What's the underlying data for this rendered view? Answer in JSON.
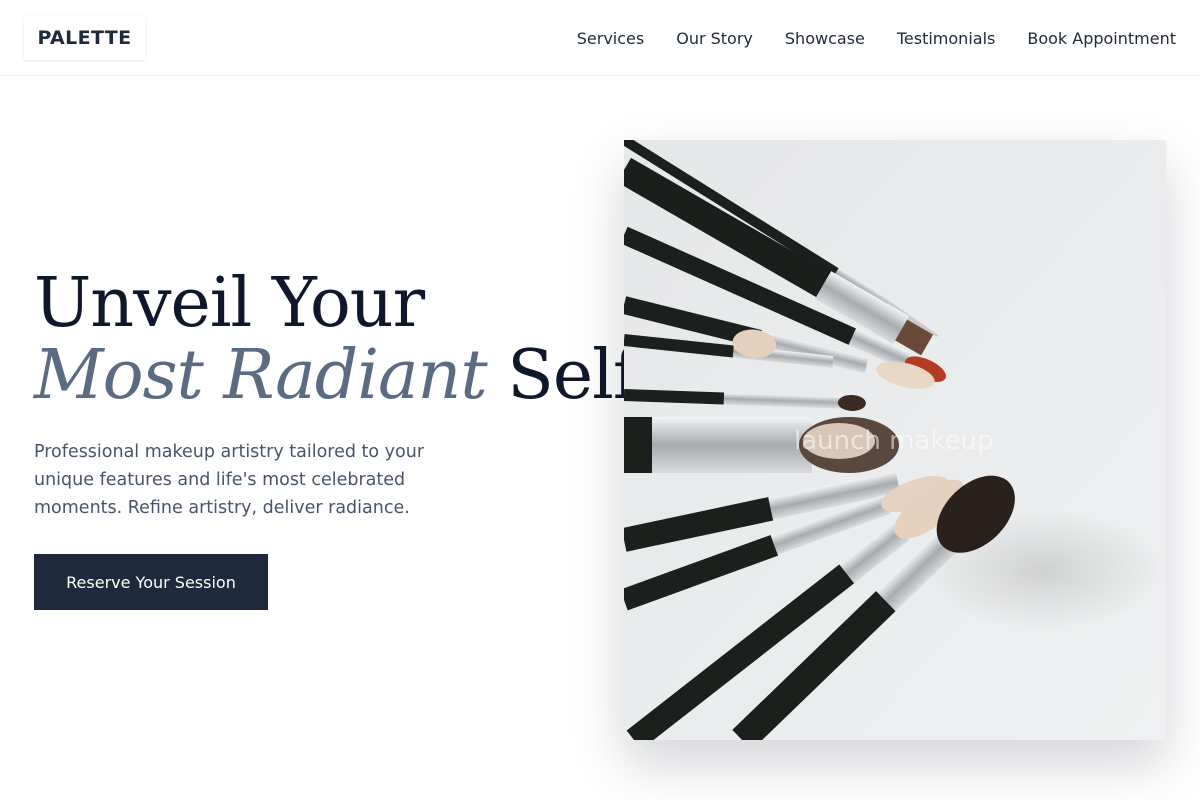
{
  "brand": {
    "logo_text": "PALETTE"
  },
  "nav": {
    "items": [
      {
        "label": "Services"
      },
      {
        "label": "Our Story"
      },
      {
        "label": "Showcase"
      },
      {
        "label": "Testimonials"
      },
      {
        "label": "Book Appointment"
      }
    ]
  },
  "hero": {
    "title_line1": "Unveil Your",
    "title_emphasis": "Most Radiant",
    "title_rest": " Self.",
    "subtitle": "Professional makeup artistry tailored to your unique features and life's most celebrated moments. Refine artistry, deliver radiance.",
    "cta_label": "Reserve Your Session"
  },
  "image": {
    "subject": "makeup-brushes",
    "watermark": "launch makeup",
    "colors": {
      "background": "#ecedef",
      "handle": "#1a1f1c",
      "ferrule": "#b9bcbf",
      "bristle_light": "#e8d4c2",
      "bristle_dark": "#2b211c",
      "bristle_red": "#b53a22"
    }
  },
  "colors": {
    "primary": "#1e293b",
    "accent_text": "#5b6b82",
    "body_text": "#475569"
  }
}
